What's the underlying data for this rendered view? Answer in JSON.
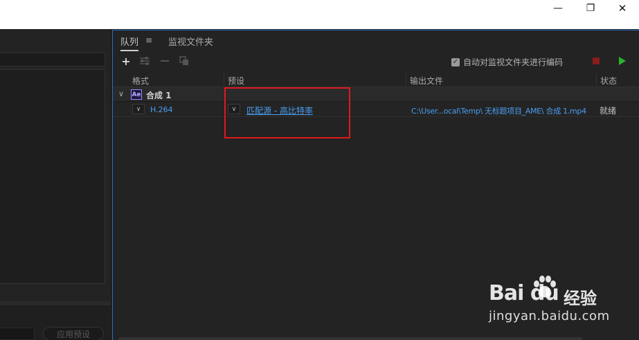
{
  "window": {
    "minimize_glyph": "—",
    "maximize_glyph": "❐",
    "close_glyph": "✕"
  },
  "left_panel": {
    "apply_preset_label": "应用预设"
  },
  "queue_panel": {
    "tabs": [
      {
        "label": "队列",
        "active": true
      },
      {
        "label": "监视文件夹",
        "active": false
      }
    ],
    "tab_menu_glyph": "≡",
    "toolbar": {
      "add_icon": "plus-icon",
      "settings_icon": "sliders-icon",
      "remove_icon": "minus-icon",
      "duplicate_icon": "duplicate-icon",
      "auto_encode_label": "自动对监视文件夹进行编码",
      "auto_encode_checked": true,
      "stop_color": "#8a1c1c",
      "start_color": "#29b42e"
    },
    "columns": [
      "格式",
      "预设",
      "输出文件",
      "状态"
    ],
    "groups": [
      {
        "badge": "Ae",
        "name": "合成 1",
        "items": [
          {
            "format": "H.264",
            "preset": "匹配源 - 高比特率",
            "output": "C:\\User...ocal\\Temp\\ 无标题项目_AME\\ 合成 1.mp4",
            "status": "就绪"
          }
        ]
      }
    ]
  },
  "watermark": {
    "brand_text": "Bai du",
    "brand_suffix": "经验",
    "url": "jingyan.baidu.com"
  },
  "colors": {
    "accent": "#2e6fc4",
    "link": "#4a9ef0",
    "highlight_box": "#e0191e"
  }
}
